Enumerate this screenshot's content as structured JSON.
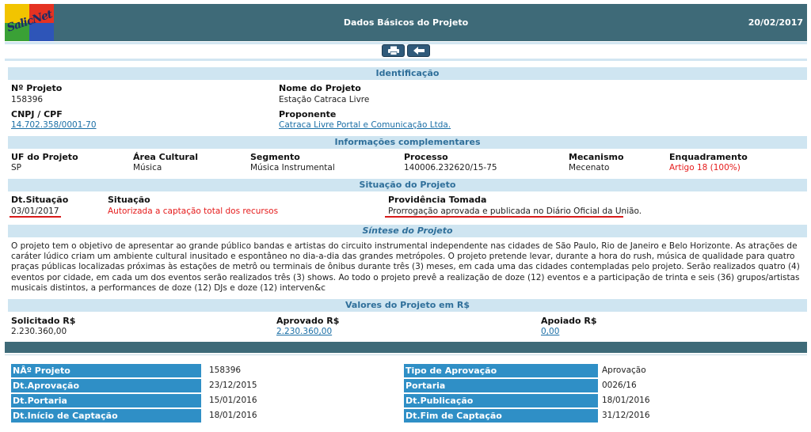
{
  "header": {
    "logo_text": "SalicNet",
    "title": "Dados Básicos do Projeto",
    "date": "20/02/2017"
  },
  "toolbar": {
    "print_label": "print",
    "back_label": "back"
  },
  "identificacao": {
    "section_title": "Identificação",
    "num_projeto_label": "Nº Projeto",
    "num_projeto": "158396",
    "nome_label": "Nome do Projeto",
    "nome": "Estação Catraca Livre",
    "cnpj_label": "CNPJ / CPF",
    "cnpj": "14.702.358/0001-70",
    "proponente_label": "Proponente",
    "proponente": "Catraca Livre Portal e Comunicação Ltda."
  },
  "complementares": {
    "section_title": "Informações complementares",
    "uf_label": "UF do Projeto",
    "uf": "SP",
    "area_label": "Área Cultural",
    "area": "Música",
    "segmento_label": "Segmento",
    "segmento": "Música Instrumental",
    "processo_label": "Processo",
    "processo": "140006.232620/15-75",
    "mecanismo_label": "Mecanismo",
    "mecanismo": "Mecenato",
    "enquadramento_label": "Enquadramento",
    "enquadramento": "Artigo 18 (100%)"
  },
  "situacao": {
    "section_title": "Situação do Projeto",
    "dt_label": "Dt.Situação",
    "dt": "03/01/2017",
    "situacao_label": "Situação",
    "situacao": "Autorizada a captação total dos recursos",
    "providencia_label": "Providência Tomada",
    "providencia": "Prorrogação aprovada e publicada no Diário Oficial da União."
  },
  "sintese": {
    "section_title": "Síntese do Projeto",
    "text": "O projeto tem o objetivo de apresentar ao grande público bandas e artistas do circuito instrumental independente nas cidades de São Paulo, Rio de Janeiro e Belo Horizonte. As atrações de caráter lúdico criam um ambiente cultural inusitado e espontâneo no dia-a-dia das grandes metrópoles. O projeto pretende levar, durante a hora do rush, música de qualidade para quatro praças públicas localizadas próximas às estações de metrô ou terminais de ônibus durante três (3) meses, em cada uma das cidades contempladas pelo projeto. Serão realizados quatro (4) eventos por cidade, em cada um dos eventos serão realizados três (3) shows. Ao todo o projeto prevê a realização de doze (12) eventos e a participação de trinta e seis (36) grupos/artistas musicais distintos, a performances de doze (12) DJs e doze (12) interven&c"
  },
  "valores": {
    "section_title": "Valores do Projeto em R$",
    "solicitado_label": "Solicitado R$",
    "solicitado": "2.230.360,00",
    "aprovado_label": "Aprovado R$",
    "aprovado": "2.230.360,00",
    "apoiado_label": "Apoiado R$",
    "apoiado": "0,00"
  },
  "aprovacao": {
    "left": [
      {
        "label": "NÂº Projeto",
        "value": "158396"
      },
      {
        "label": "Dt.Aprovação",
        "value": "23/12/2015"
      },
      {
        "label": "Dt.Portaria",
        "value": "15/01/2016"
      },
      {
        "label": "Dt.Início de Captação",
        "value": "18/01/2016"
      }
    ],
    "right": [
      {
        "label": "Tipo de Aprovação",
        "value": "Aprovação"
      },
      {
        "label": "Portaria",
        "value": "0026/16"
      },
      {
        "label": "Dt.Publicação",
        "value": "18/01/2016"
      },
      {
        "label": "Dt.Fim de Captação",
        "value": "31/12/2016"
      }
    ]
  }
}
